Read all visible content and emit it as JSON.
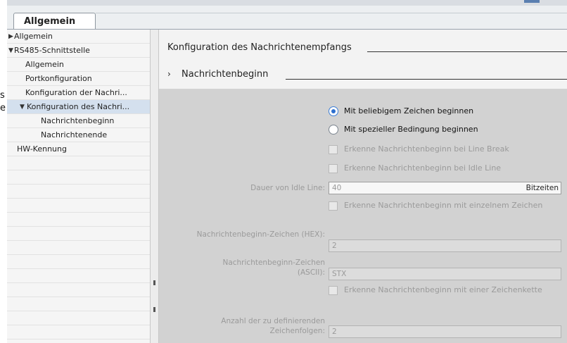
{
  "clipped_text": {
    "line1": "s",
    "line2": "e"
  },
  "tab": {
    "label": "Allgemein"
  },
  "nav": {
    "items": [
      {
        "label": "Allgemein",
        "arrow": "▶"
      },
      {
        "label": "RS485-Schnittstelle",
        "arrow": "▼"
      },
      {
        "label": "Allgemein",
        "arrow": ""
      },
      {
        "label": "Portkonfiguration",
        "arrow": ""
      },
      {
        "label": "Konfiguration der Nachri...",
        "arrow": ""
      },
      {
        "label": "Konfiguration des Nachri...",
        "arrow": "▼"
      },
      {
        "label": "Nachrichtenbeginn",
        "arrow": ""
      },
      {
        "label": "Nachrichtenende",
        "arrow": ""
      },
      {
        "label": "HW-Kennung",
        "arrow": ""
      }
    ]
  },
  "content": {
    "section_title": "Konfiguration des Nachrichtenempfangs",
    "subsection_arrow": "›",
    "subsection_title": "Nachrichtenbeginn",
    "radio_any": "Mit beliebigem Zeichen beginnen",
    "radio_special": "Mit spezieller Bedingung beginnen",
    "chk_line_break": "Erkenne Nachrichtenbeginn bei Line Break",
    "chk_idle_line": "Erkenne Nachrichtenbeginn bei Idle Line",
    "idle_label": "Dauer von Idle Line:",
    "idle_value": "40",
    "idle_unit": "Bitzeiten",
    "chk_single_char": "Erkenne Nachrichtenbeginn mit einzelnem Zeichen",
    "hex_label": "Nachrichtenbeginn-Zeichen (HEX):",
    "hex_value": "2",
    "ascii_label": "Nachrichtenbeginn-Zeichen (ASCII):",
    "ascii_value": "STX",
    "chk_string": "Erkenne Nachrichtenbeginn mit einer Zeichenkette",
    "count_label": "Anzahl der zu definierenden Zeichenfolgen:",
    "count_value": "2"
  },
  "colors": {
    "selection": "#d4e0ee",
    "radio_accent": "#2d6fcf",
    "panel": "#d2d2d2"
  }
}
